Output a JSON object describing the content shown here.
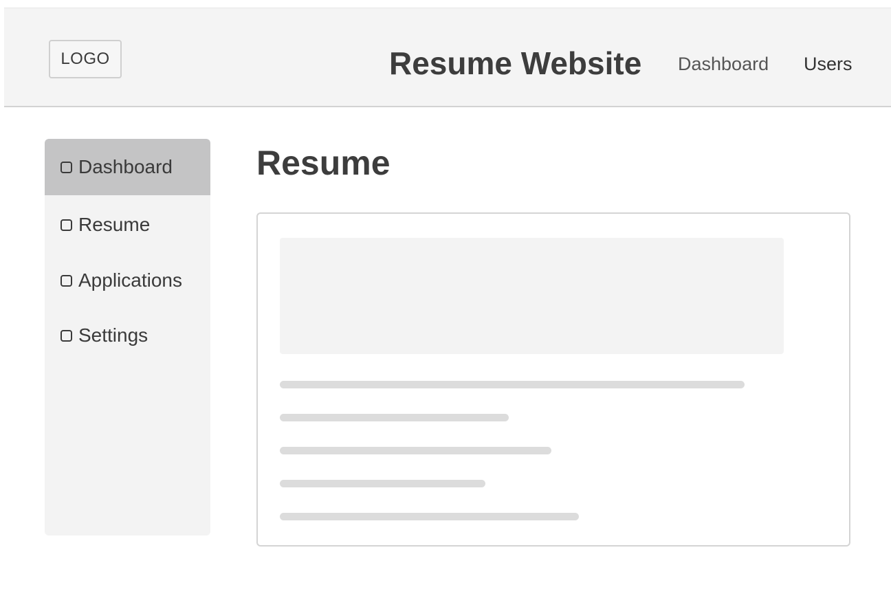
{
  "header": {
    "logo_label": "LOGO",
    "site_title": "Resume Website",
    "nav": [
      {
        "label": "Dashboard"
      },
      {
        "label": "Users"
      }
    ]
  },
  "sidebar": {
    "active_index": 0,
    "items": [
      {
        "label": "Dashboard",
        "icon": "square-icon"
      },
      {
        "label": "Resume",
        "icon": "square-icon"
      },
      {
        "label": "Applications",
        "icon": "square-icon"
      },
      {
        "label": "Settings",
        "icon": "square-icon"
      }
    ]
  },
  "main": {
    "title": "Resume"
  },
  "colors": {
    "header_bg": "#f4f4f4",
    "sidebar_bg": "#f3f3f3",
    "sidebar_active_bg": "#c4c4c5",
    "placeholder_bg": "#f3f3f3",
    "skeleton_line": "#dcdcdc",
    "text": "#3a3a3a"
  }
}
